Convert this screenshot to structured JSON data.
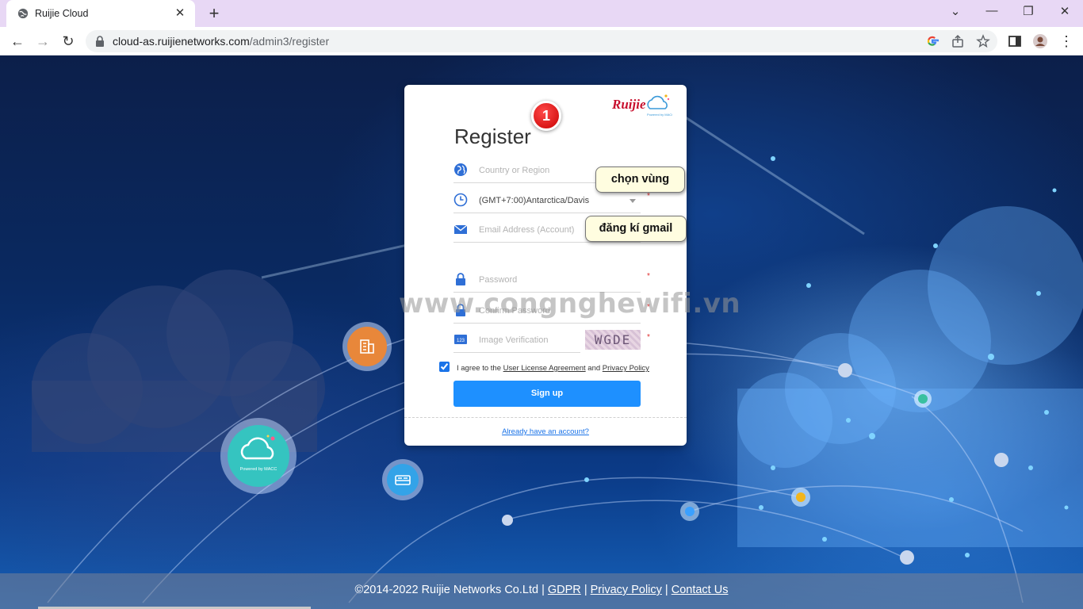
{
  "browser": {
    "tab_title": "Ruijie Cloud",
    "url_host": "cloud-as.ruijienetworks.com",
    "url_path": "/admin3/register",
    "new_tab_label": "+",
    "close_tab_label": "✕"
  },
  "card": {
    "title": "Register",
    "badge_number": "1",
    "country_placeholder": "Country or Region",
    "timezone_value": "(GMT+7:00)Antarctica/Davis",
    "email_placeholder": "Email Address (Account)",
    "password_placeholder": "Password",
    "confirm_placeholder": "Confirm Password",
    "captcha_placeholder": "Image Verification",
    "captcha_text": "WGDE",
    "agree_prefix": "I agree to the",
    "license_link": "User License Agreement",
    "agree_and": "and",
    "privacy_link": "Privacy Policy",
    "signup_label": "Sign up",
    "already_link": "Already have an account?",
    "required_mark": "*"
  },
  "tooltips": {
    "region": "chọn vùng",
    "gmail": "đăng kí gmail"
  },
  "watermark": "www.congnghewifi.vn",
  "footer": {
    "copyright": "©2014-2022 Ruijie Networks Co.Ltd",
    "sep": "|",
    "gdpr": "GDPR",
    "privacy": "Privacy Policy",
    "contact": "Contact Us"
  },
  "colors": {
    "primary": "#1e90ff",
    "tabbar": "#e8d8f5"
  }
}
